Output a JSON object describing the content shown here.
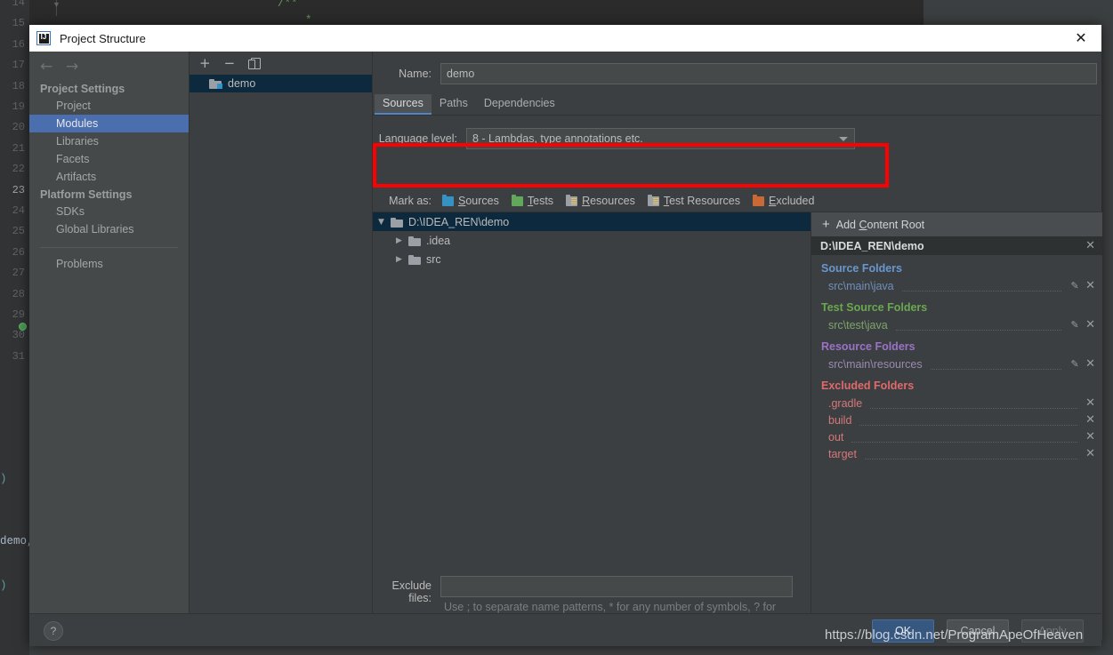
{
  "editor": {
    "line_numbers": [
      "14",
      "15",
      "16",
      "17",
      "18",
      "19",
      "20",
      "21",
      "22",
      "23",
      "24",
      "25",
      "26",
      "27",
      "28",
      "29",
      "30",
      "31"
    ],
    "current_line": "23",
    "code_tokens": [
      {
        "text": "/**",
        "color": "#629755"
      },
      {
        "text": "*",
        "color": "#629755"
      }
    ],
    "lower_tokens": [
      {
        "text": ")",
        "color": "#5f9ea0"
      },
      {
        "text": "demo,",
        "color": "#a9b7c6"
      },
      {
        "text": ")",
        "color": "#5f9ea0"
      }
    ]
  },
  "dialog": {
    "title": "Project Structure",
    "icon": "intellij-idea-icon",
    "close_label": "✕"
  },
  "sidebar": {
    "back_label": "←",
    "forward_label": "→",
    "groups": [
      {
        "title": "Project Settings",
        "items": [
          {
            "label": "Project",
            "selected": false
          },
          {
            "label": "Modules",
            "selected": true
          },
          {
            "label": "Libraries",
            "selected": false
          },
          {
            "label": "Facets",
            "selected": false
          },
          {
            "label": "Artifacts",
            "selected": false
          }
        ]
      },
      {
        "title": "Platform Settings",
        "items": [
          {
            "label": "SDKs",
            "selected": false
          },
          {
            "label": "Global Libraries",
            "selected": false
          }
        ]
      }
    ],
    "problems_label": "Problems"
  },
  "modules": {
    "toolbar": {
      "add_label": "+",
      "remove_label": "−",
      "copy_label": "copy-icon"
    },
    "items": [
      {
        "label": "demo",
        "selected": true
      }
    ]
  },
  "main": {
    "name_label": "Name:",
    "name_value": "demo",
    "tabs": [
      {
        "label": "Sources",
        "selected": true
      },
      {
        "label": "Paths",
        "selected": false
      },
      {
        "label": "Dependencies",
        "selected": false
      }
    ],
    "language_level": {
      "label": "Language level:",
      "value": "8 - Lambdas, type annotations etc.",
      "arrow": "chevron-down-icon",
      "highlight_color": "#ff0000"
    },
    "mark_as": {
      "label": "Mark as:",
      "options": [
        {
          "label": "Sources",
          "mnemonic": "S",
          "rest": "ources",
          "color": "#3592c4"
        },
        {
          "label": "Tests",
          "mnemonic": "T",
          "rest": "ests",
          "color": "#62a85a"
        },
        {
          "label": "Resources",
          "mnemonic": "R",
          "rest": "esources",
          "color": "#9aa0a6"
        },
        {
          "label": "Test Resources",
          "mnemonic": "T",
          "rest": "est Resources",
          "color": "#9aa0a6"
        },
        {
          "label": "Excluded",
          "mnemonic": "E",
          "rest": "xcluded",
          "color": "#c96935"
        }
      ]
    },
    "tree": [
      {
        "label": "D:\\IDEA_REN\\demo",
        "twisty": "▼",
        "indent": 0,
        "selected": true
      },
      {
        "label": ".idea",
        "twisty": "▶",
        "indent": 1,
        "selected": false
      },
      {
        "label": "src",
        "twisty": "▶",
        "indent": 1,
        "selected": false
      }
    ],
    "exclude_files": {
      "label": "Exclude files:",
      "value": "",
      "hint": "Use ; to separate name patterns, * for any number of symbols, ? for one."
    }
  },
  "roots_panel": {
    "add_content_root": {
      "plus": "+",
      "pre": "Add ",
      "mnemonic": "C",
      "rest": "ontent Root"
    },
    "root_header": {
      "label": "D:\\IDEA_REN\\demo",
      "close": "✕"
    },
    "groups": [
      {
        "title": "Source Folders",
        "title_color": "#6897d0",
        "entry_color": "#6f8fb8",
        "entries": [
          {
            "path": "src\\main\\java",
            "has_pencil": true,
            "close": "✕"
          }
        ]
      },
      {
        "title": "Test Source Folders",
        "title_color": "#6aa84f",
        "entry_color": "#7da46a",
        "entries": [
          {
            "path": "src\\test\\java",
            "has_pencil": true,
            "close": "✕"
          }
        ]
      },
      {
        "title": "Resource Folders",
        "title_color": "#9b72c6",
        "entry_color": "#9a8ab0",
        "entries": [
          {
            "path": "src\\main\\resources",
            "has_pencil": true,
            "close": "✕"
          }
        ]
      },
      {
        "title": "Excluded Folders",
        "title_color": "#e2696b",
        "entry_color": "#d4787a",
        "entries": [
          {
            "path": ".gradle",
            "has_pencil": false,
            "close": "✕"
          },
          {
            "path": "build",
            "has_pencil": false,
            "close": "✕"
          },
          {
            "path": "out",
            "has_pencil": false,
            "close": "✕"
          },
          {
            "path": "target",
            "has_pencil": false,
            "close": "✕"
          }
        ]
      }
    ]
  },
  "footer": {
    "help_label": "?",
    "buttons": [
      {
        "label": "OK",
        "style": "primary"
      },
      {
        "label": "Cancel",
        "style": "normal"
      },
      {
        "label": "Apply",
        "style": "disabled"
      }
    ]
  },
  "watermark": "https://blog.csdn.net/ProgramApeOfHeaven"
}
